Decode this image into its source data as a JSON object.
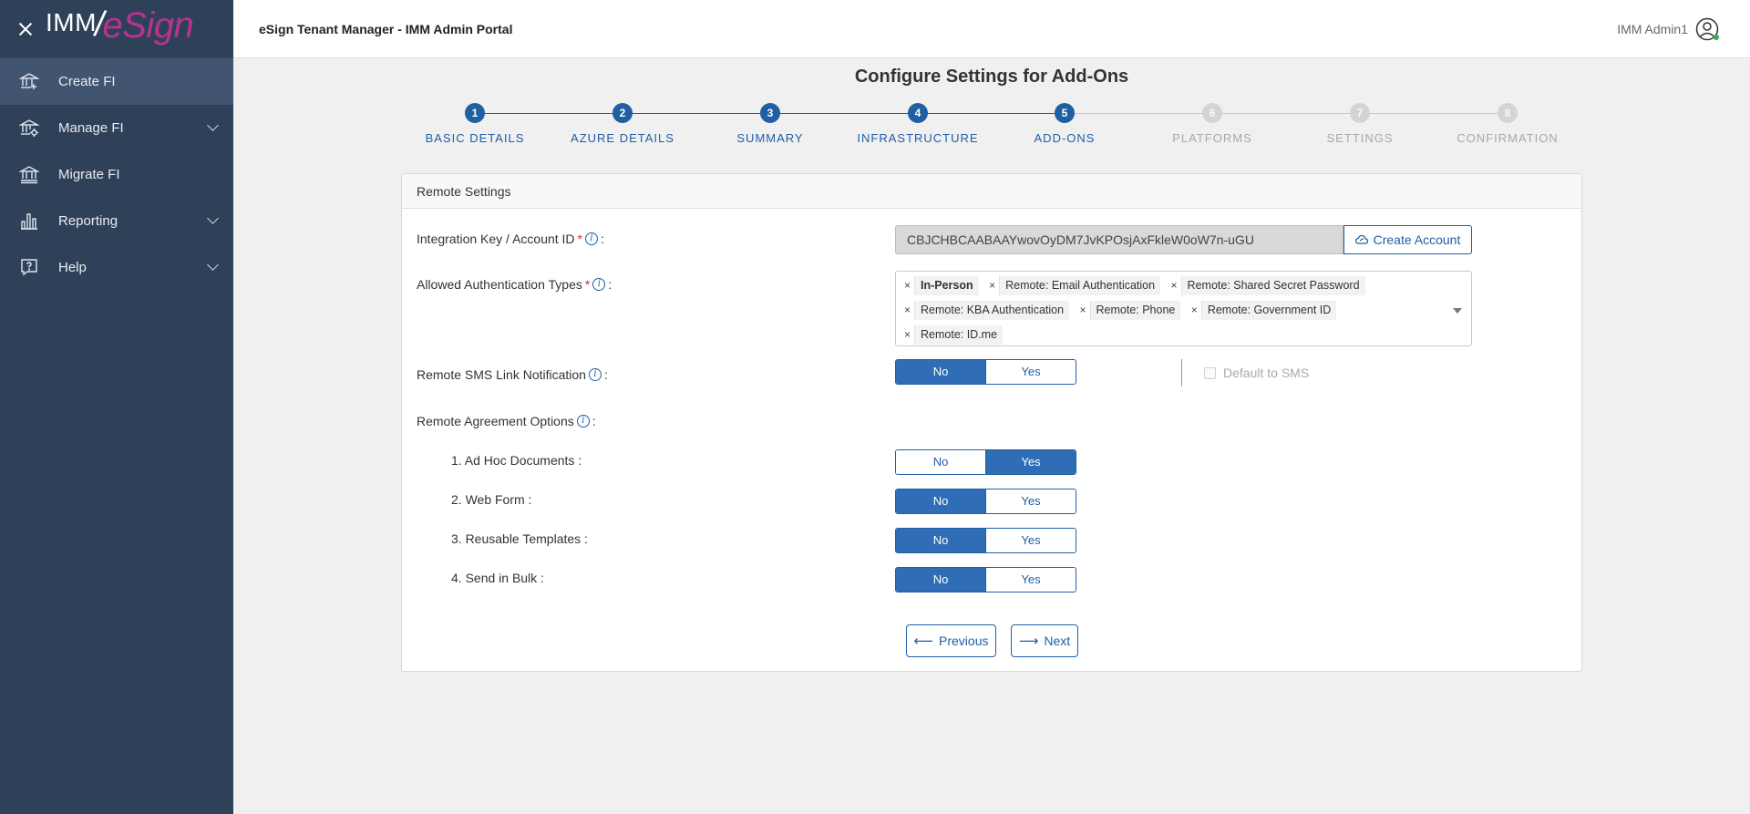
{
  "header": {
    "app_title": "eSign Tenant Manager - IMM Admin Portal",
    "user_name": "IMM Admin1"
  },
  "logo": {
    "imm": "IMM",
    "esign": "eSign"
  },
  "sidebar": {
    "items": [
      {
        "label": "Create FI",
        "icon": "bank-icon",
        "active": true,
        "has_submenu": false
      },
      {
        "label": "Manage FI",
        "icon": "bank-gear-icon",
        "active": false,
        "has_submenu": true
      },
      {
        "label": "Migrate FI",
        "icon": "bank-arrow-icon",
        "active": false,
        "has_submenu": false
      },
      {
        "label": "Reporting",
        "icon": "bar-chart-icon",
        "active": false,
        "has_submenu": true
      },
      {
        "label": "Help",
        "icon": "help-icon",
        "active": false,
        "has_submenu": true
      }
    ]
  },
  "page": {
    "title": "Configure Settings for Add-Ons"
  },
  "stepper": {
    "current": 5,
    "steps": [
      {
        "num": "1",
        "label": "BASIC DETAILS",
        "state": "done"
      },
      {
        "num": "2",
        "label": "AZURE DETAILS",
        "state": "done"
      },
      {
        "num": "3",
        "label": "SUMMARY",
        "state": "done"
      },
      {
        "num": "4",
        "label": "INFRASTRUCTURE",
        "state": "done"
      },
      {
        "num": "5",
        "label": "ADD-ONS",
        "state": "current"
      },
      {
        "num": "6",
        "label": "PLATFORMS",
        "state": "pending"
      },
      {
        "num": "7",
        "label": "SETTINGS",
        "state": "pending"
      },
      {
        "num": "8",
        "label": "CONFIRMATION",
        "state": "pending"
      }
    ]
  },
  "card": {
    "title": "Remote Settings",
    "integration_key": {
      "label": "Integration Key / Account ID",
      "suffix": ":",
      "value": "CBJCHBCAABAAYwovOyDM7JvKPOsjAxFkleW0oW7n-uGU",
      "button": "Create Account"
    },
    "auth_types": {
      "label": "Allowed Authentication Types",
      "suffix": ":",
      "tags": [
        "In-Person",
        "Remote: Email Authentication",
        "Remote: Shared Secret Password",
        "Remote: KBA Authentication",
        "Remote: Phone",
        "Remote: Government ID",
        "Remote: ID.me"
      ]
    },
    "sms": {
      "label": "Remote SMS Link Notification",
      "suffix": ":",
      "no": "No",
      "yes": "Yes",
      "selected": "No",
      "default_label": "Default to SMS",
      "default_checked": false
    },
    "agreement": {
      "label": "Remote Agreement Options",
      "suffix": ":",
      "options": [
        {
          "label": "1. Ad Hoc Documents :",
          "no": "No",
          "yes": "Yes",
          "selected": "Yes"
        },
        {
          "label": "2. Web Form :",
          "no": "No",
          "yes": "Yes",
          "selected": "No"
        },
        {
          "label": "3. Reusable Templates :",
          "no": "No",
          "yes": "Yes",
          "selected": "No"
        },
        {
          "label": "4. Send in Bulk :",
          "no": "No",
          "yes": "Yes",
          "selected": "No"
        }
      ]
    },
    "nav": {
      "previous": "Previous",
      "next": "Next"
    }
  },
  "colors": {
    "sidebar_bg": "#2f4159",
    "primary": "#1f5fa3",
    "toggle_on": "#2f6eb6",
    "required": "#d0312d",
    "logo_esign": "#b8338e"
  }
}
